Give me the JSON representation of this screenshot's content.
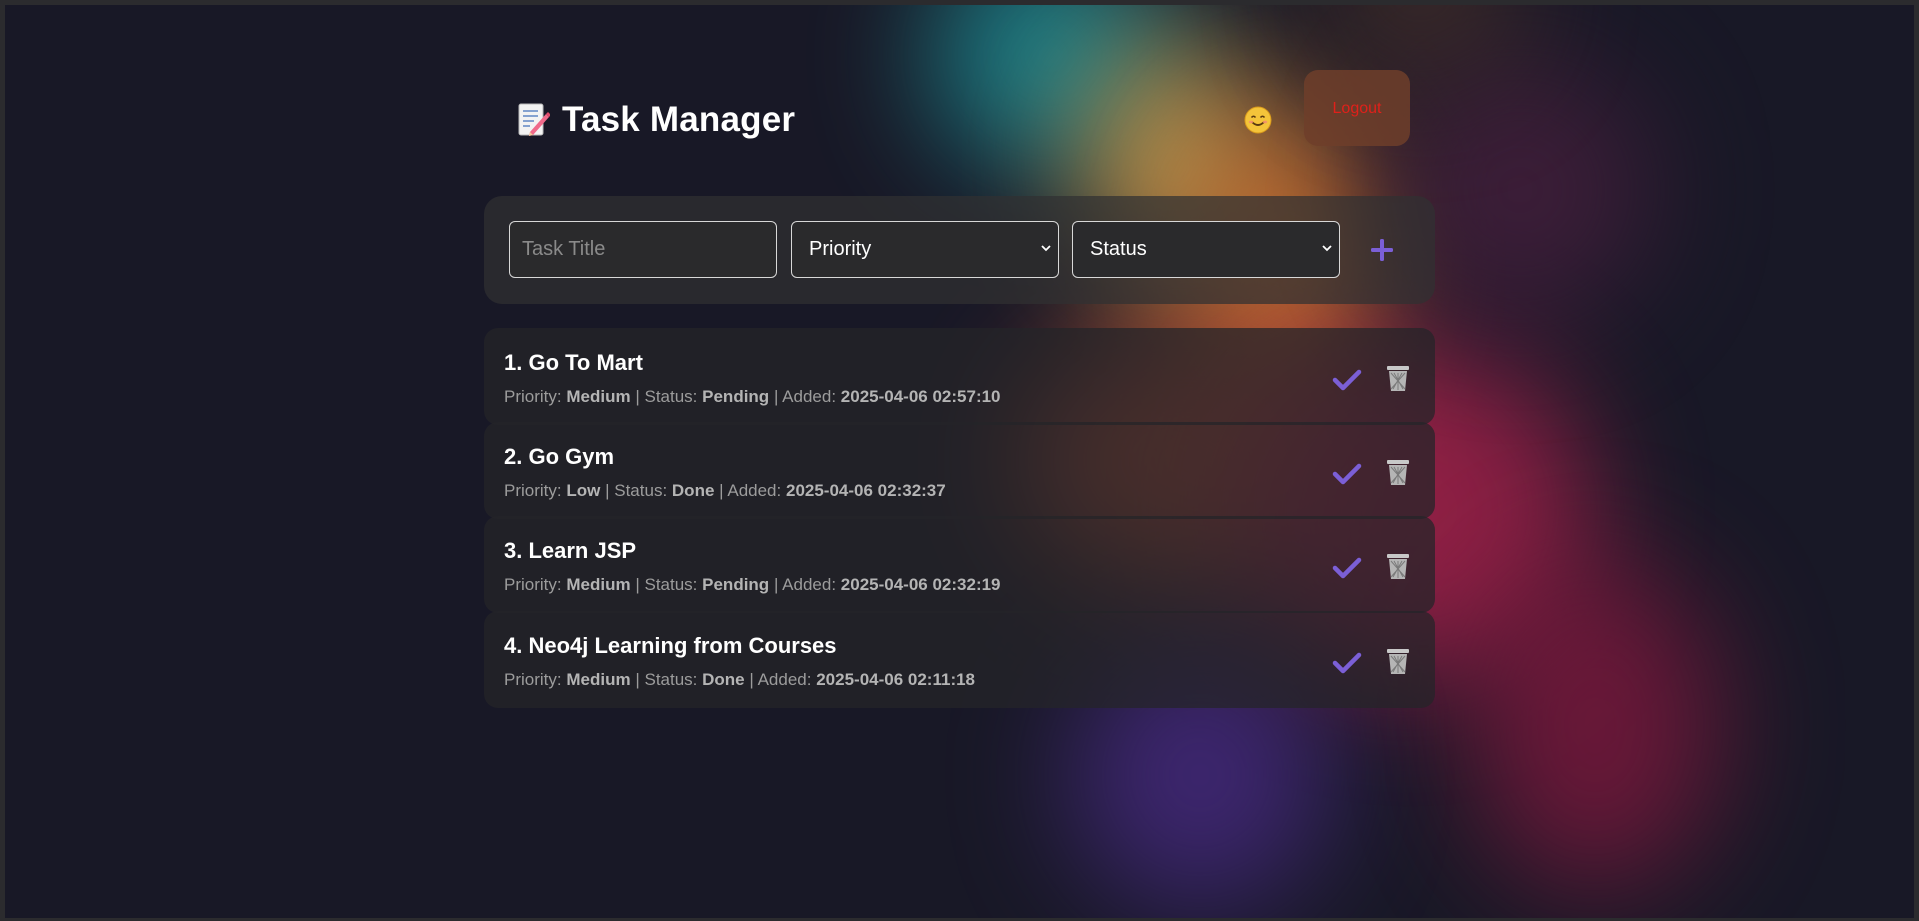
{
  "app": {
    "title": "Task Manager"
  },
  "header": {
    "logout_label": "Logout"
  },
  "form": {
    "title_placeholder": "Task Title",
    "priority_select": "Priority",
    "status_select": "Status"
  },
  "labels": {
    "priority": "Priority:",
    "status": "Status:",
    "added": "Added:",
    "sep": "|"
  },
  "tasks": [
    {
      "title": "1. Go To Mart",
      "priority": "Medium",
      "status": "Pending",
      "added": "2025-04-06 02:57:10"
    },
    {
      "title": "2. Go Gym",
      "priority": "Low",
      "status": "Done",
      "added": "2025-04-06 02:32:37"
    },
    {
      "title": "3. Learn JSP",
      "priority": "Medium",
      "status": "Pending",
      "added": "2025-04-06 02:32:19"
    },
    {
      "title": "4. Neo4j Learning from Courses",
      "priority": "Medium",
      "status": "Done",
      "added": "2025-04-06 02:11:18"
    }
  ],
  "icons": {
    "title": "memo-icon",
    "user": "smiling-face-icon",
    "add": "plus-icon",
    "complete": "checkmark-icon",
    "delete": "wastebasket-icon"
  },
  "colors": {
    "background": "#181826",
    "accent": "#7b5fd6",
    "logout_text": "#e0201a",
    "logout_bg": "#6e3e2a"
  }
}
